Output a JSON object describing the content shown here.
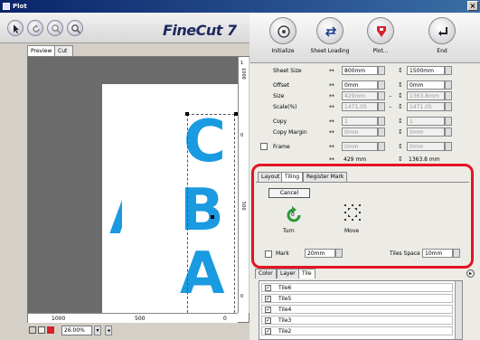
{
  "window": {
    "title": "Plot",
    "close_glyph": "×"
  },
  "app": {
    "logo": "FineCut 7"
  },
  "toolbar_right": [
    {
      "label": "Initialize",
      "icon": "initialize-icon"
    },
    {
      "label": "Sheet Loading",
      "icon": "sheet-loading-icon"
    },
    {
      "label": "Plot...",
      "icon": "plot-icon"
    },
    {
      "label": "End",
      "icon": "end-icon"
    }
  ],
  "preview_tabs": [
    "Preview",
    "Cut Line"
  ],
  "canvas": {
    "letters": [
      "C",
      "B",
      "A",
      "A"
    ],
    "ruler_h": [
      "1000",
      "500",
      "0"
    ],
    "ruler_v": [
      "0",
      "1000",
      "500",
      "0",
      "1"
    ],
    "zoom": "26.00%"
  },
  "settings": {
    "sheet_size": {
      "label": "Sheet Size",
      "w": "800mm",
      "h": "1500mm"
    },
    "offset": {
      "label": "Offset",
      "w": "0mm",
      "h": "0mm"
    },
    "size": {
      "label": "Size",
      "w": "429mm",
      "h": "1363.8mm"
    },
    "scale": {
      "label": "Scale(%)",
      "w": "1471.05",
      "h": "1471.05"
    },
    "copy": {
      "label": "Copy",
      "w": "1",
      "h": "1"
    },
    "copy_margin": {
      "label": "Copy Margin",
      "w": "0mm",
      "h": "0mm"
    },
    "frame": {
      "label": "Frame",
      "w": "0mm",
      "h": "0mm"
    },
    "total": {
      "w": "429 mm",
      "h": "1363.8 mm"
    }
  },
  "tiling_panel": {
    "tabs": [
      "Layout",
      "Tiling",
      "Register Mark"
    ],
    "cancel_label": "Cancel",
    "turn_label": "Turn",
    "turn_value": "0",
    "move_label": "Move",
    "mark_label": "Mark",
    "mark_value": "20mm",
    "tiles_space_label": "Tiles Space",
    "tiles_space_value": "10mm"
  },
  "lower_tabs": [
    "Color",
    "Layer",
    "Tile"
  ],
  "tiles": [
    "Tile6",
    "Tile5",
    "Tile4",
    "Tile3",
    "Tile2"
  ],
  "colors": {
    "accent_blue": "#1a9ae0",
    "highlight_red": "#e21522",
    "plot_red": "#d8202a",
    "initialize_green": "#2a9a3a"
  }
}
